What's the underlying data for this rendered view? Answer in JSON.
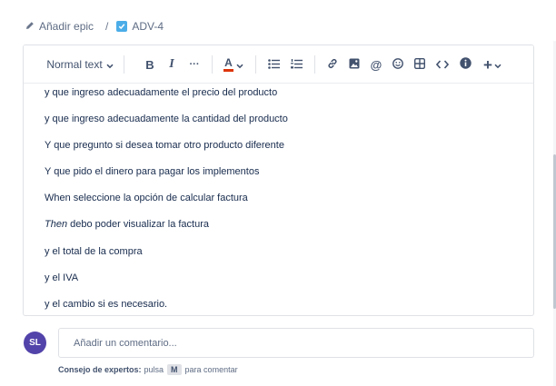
{
  "breadcrumb": {
    "epic_label": "Añadir epic",
    "separator": "/",
    "issue_key": "ADV-4"
  },
  "toolbar": {
    "text_style": "Normal text",
    "bold": "B",
    "italic": "I",
    "more": "···",
    "text_color_letter": "A",
    "text_color_accent": "#de350b",
    "insert_plus": "+"
  },
  "editor": {
    "lines": [
      {
        "text": "y que ingreso adecuadamente el precio del producto"
      },
      {
        "text": "y que ingreso adecuadamente la cantidad del producto"
      },
      {
        "text": "Y que pregunto si desea tomar otro producto diferente"
      },
      {
        "text": "Y que pido el dinero para pagar los implementos"
      },
      {
        "text": "When seleccione la opción de calcular factura"
      },
      {
        "prefix": "Then",
        "text": " debo poder visualizar la factura"
      },
      {
        "text": "y el total de la compra"
      },
      {
        "text": "y el IVA"
      },
      {
        "text": "y el cambio si es necesario."
      }
    ]
  },
  "comment": {
    "avatar_initials": "SL",
    "avatar_color": "#5243aa",
    "placeholder": "Añadir un comentario...",
    "tip_bold": "Consejo de expertos:",
    "tip_text": "pulsa",
    "tip_key": "M",
    "tip_suffix": "para comentar"
  },
  "colors": {
    "checkbox": "#4bade8",
    "text": "#172b4d",
    "muted": "#5e6c84"
  },
  "icons": {
    "epic": "pencil-icon",
    "issue_type": "checkbox-icon",
    "link": "link-icon",
    "image": "image-icon",
    "mention": "mention-icon",
    "emoji": "emoji-icon",
    "table": "table-icon",
    "code": "code-icon",
    "info": "info-icon"
  }
}
